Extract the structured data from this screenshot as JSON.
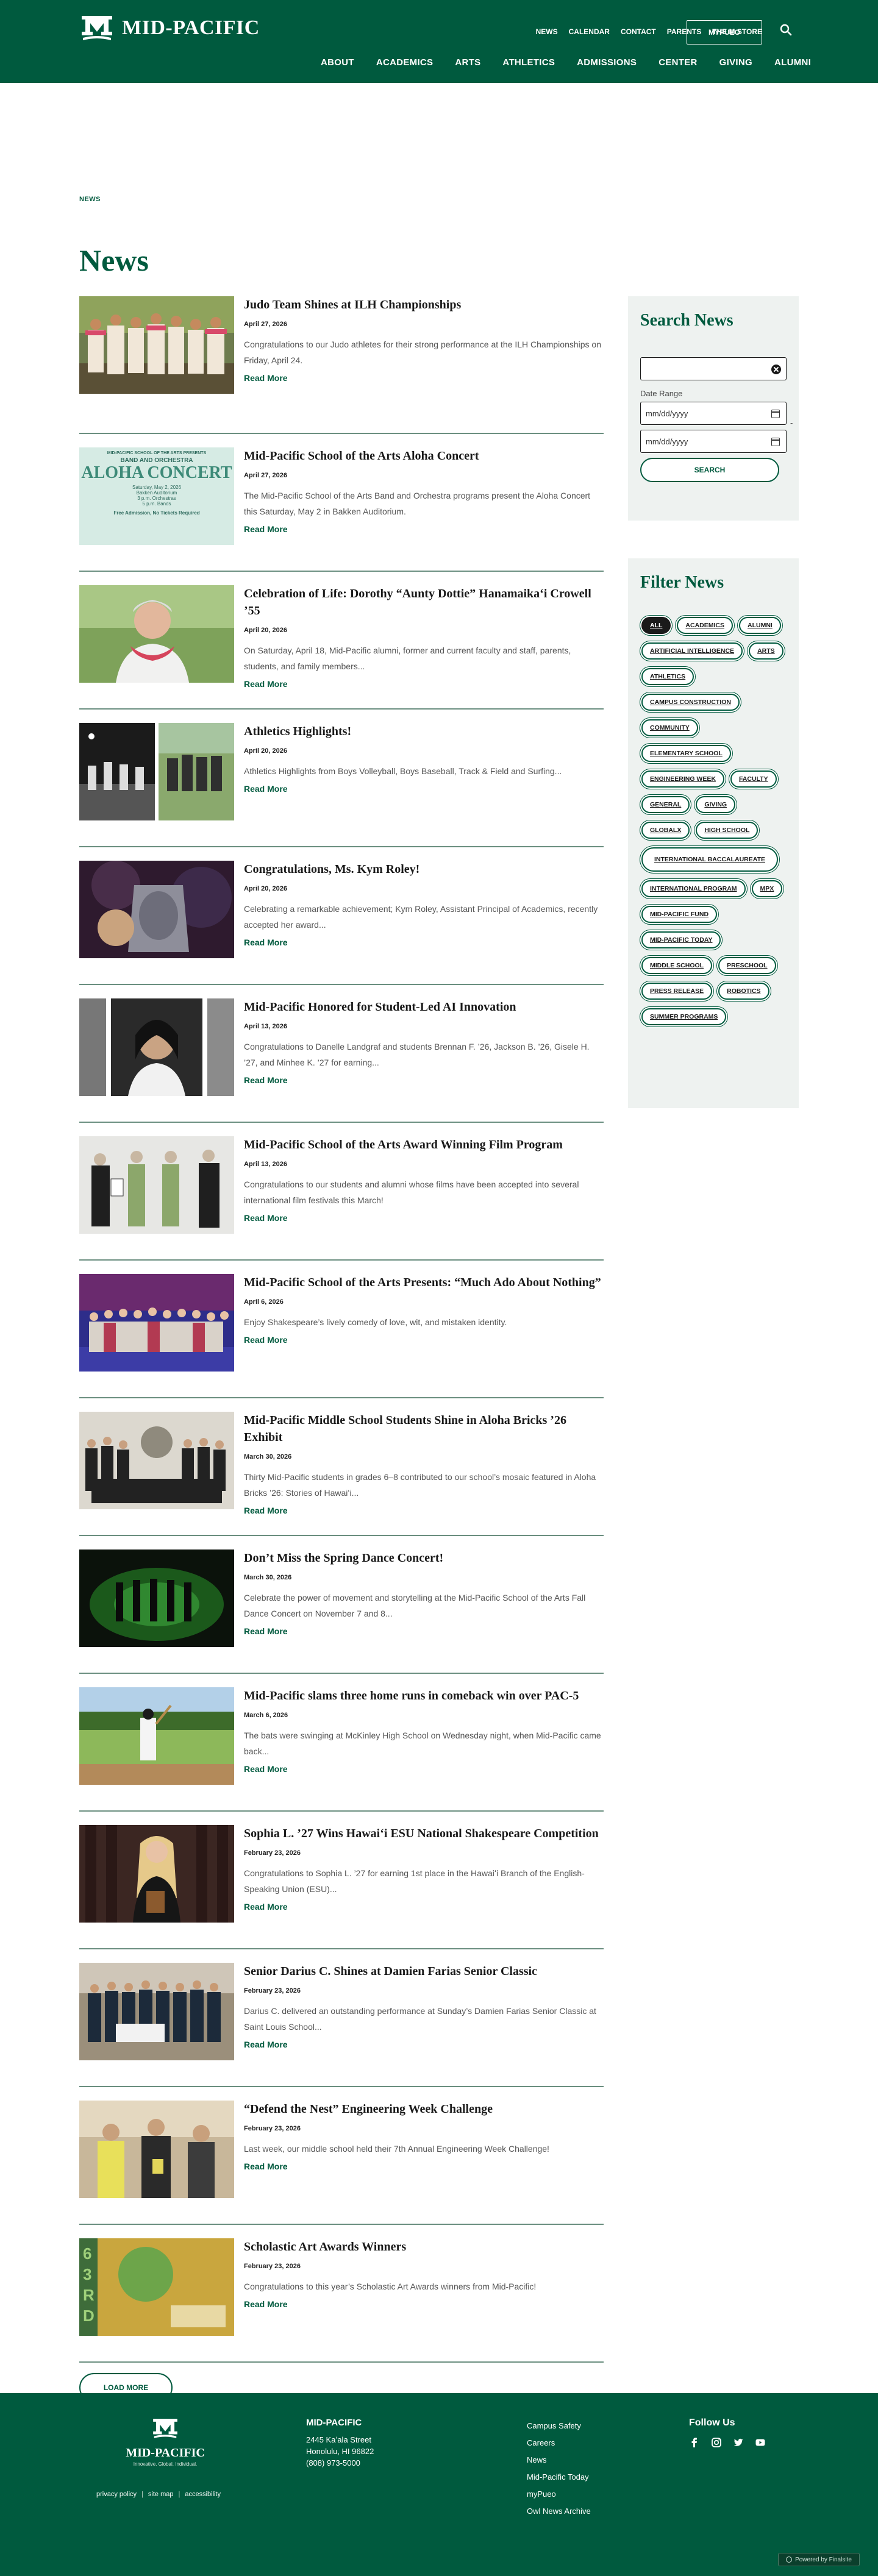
{
  "header": {
    "logo_text": "MID-PACIFIC",
    "util_nav": [
      "NEWS",
      "CALENDAR",
      "CONTACT",
      "PARENTS",
      "THE M STORE"
    ],
    "mypueo_label": "MYPUEO",
    "main_nav": [
      "ABOUT",
      "ACADEMICS",
      "ARTS",
      "ATHLETICS",
      "ADMISSIONS",
      "CENTER",
      "GIVING",
      "ALUMNI"
    ]
  },
  "breadcrumb": "NEWS",
  "page_title": "News",
  "read_more_label": "Read More",
  "news": [
    {
      "title": "Judo Team Shines at ILH Championships",
      "date": "April 27, 2026",
      "excerpt": "Congratulations to our Judo athletes for their strong performance at the ILH Championships on Friday, April 24."
    },
    {
      "title": "Mid-Pacific School of the Arts Aloha Concert",
      "date": "April 27, 2026",
      "excerpt": "The Mid-Pacific School of the Arts Band and Orchestra programs present the Aloha Concert this Saturday, May 2 in Bakken Auditorium."
    },
    {
      "title": "Celebration of Life: Dorothy “Aunty Dottie” Hanamaikaʻi Crowell ’55",
      "date": "April 20, 2026",
      "excerpt": "On Saturday, April 18, Mid-Pacific alumni, former and current faculty and staff, parents, students, and family members..."
    },
    {
      "title": "Athletics Highlights!",
      "date": "April 20, 2026",
      "excerpt": "Athletics Highlights from Boys Volleyball, Boys Baseball, Track & Field and Surfing..."
    },
    {
      "title": "Congratulations, Ms. Kym Roley!",
      "date": "April 20, 2026",
      "excerpt": "Celebrating a remarkable achievement; Kym Roley, Assistant Principal of Academics, recently accepted her award..."
    },
    {
      "title": "Mid-Pacific Honored for Student-Led AI Innovation",
      "date": "April 13, 2026",
      "excerpt": "Congratulations to Danelle Landgraf and students Brennan F. ’26, Jackson B. ’26, Gisele H. ’27, and Minhee K. ’27 for earning..."
    },
    {
      "title": "Mid-Pacific School of the Arts Award Winning Film Program",
      "date": "April 13, 2026",
      "excerpt": "Congratulations to our students and alumni whose films have been accepted into several international film festivals this March!"
    },
    {
      "title": "Mid-Pacific School of the Arts Presents: “Much Ado About Nothing”",
      "date": "April 6, 2026",
      "excerpt": "Enjoy Shakespeare’s lively comedy of love, wit, and mistaken identity."
    },
    {
      "title": "Mid-Pacific Middle School Students Shine in Aloha Bricks ’26 Exhibit",
      "date": "March 30, 2026",
      "excerpt": "Thirty Mid-Pacific students in grades 6–8 contributed to our school’s mosaic featured in Aloha Bricks ’26: Stories of Hawaiʻi..."
    },
    {
      "title": "Don’t Miss the Spring Dance Concert!",
      "date": "March 30, 2026",
      "excerpt": "Celebrate the power of movement and storytelling at the Mid-Pacific School of the Arts Fall Dance Concert on November 7 and 8..."
    },
    {
      "title": "Mid-Pacific slams three home runs in comeback win over PAC-5",
      "date": "March 6, 2026",
      "excerpt": "The bats were swinging at McKinley High School on Wednesday night, when Mid-Pacific came back..."
    },
    {
      "title": "Sophia L. ’27 Wins Hawaiʻi ESU National Shakespeare Competition",
      "date": "February 23, 2026",
      "excerpt": "Congratulations to Sophia L. ’27 for earning 1st place in the Hawaiʻi Branch of the English-Speaking Union (ESU)..."
    },
    {
      "title": "Senior Darius C. Shines at Damien Farias Senior Classic",
      "date": "February 23, 2026",
      "excerpt": "Darius C. delivered an outstanding performance at Sunday’s Damien Farias Senior Classic at Saint Louis School..."
    },
    {
      "title": "“Defend the Nest” Engineering Week Challenge",
      "date": "February 23, 2026",
      "excerpt": "Last week, our middle school held their 7th Annual Engineering Week Challenge!"
    },
    {
      "title": "Scholastic Art Awards Winners",
      "date": "February 23, 2026",
      "excerpt": "Congratulations to this year’s Scholastic Art Awards winners from Mid-Pacific!"
    }
  ],
  "load_more_label": "LOAD MORE",
  "search_panel": {
    "heading": "Search News",
    "date_range_label": "Date Range",
    "date_placeholder": "mm/dd/yyyy",
    "dash": "-",
    "search_button": "SEARCH"
  },
  "filter_panel": {
    "heading": "Filter News",
    "tags": [
      "ALL",
      "ACADEMICS",
      "ALUMNI",
      "ARTIFICIAL INTELLIGENCE",
      "ARTS",
      "ATHLETICS",
      "CAMPUS CONSTRUCTION",
      "COMMUNITY",
      "ELEMENTARY SCHOOL",
      "ENGINEERING WEEK",
      "FACULTY",
      "GENERAL",
      "GIVING",
      "GLOBALX",
      "HIGH SCHOOL",
      "INTERNATIONAL BACCALAUREATE",
      "INTERNATIONAL PROGRAM",
      "MPX",
      "MID-PACIFIC FUND",
      "MID-PACIFIC TODAY",
      "MIDDLE SCHOOL",
      "PRESCHOOL",
      "PRESS RELEASE",
      "ROBOTICS",
      "SUMMER PROGRAMS"
    ]
  },
  "aloha_concert": {
    "school": "MID-PACIFIC SCHOOL OF THE ARTS PRESENTS",
    "program": "BAND AND ORCHESTRA",
    "title": "ALOHA CONCERT",
    "details": [
      "Saturday, May 2, 2026",
      "Bakken Auditorium",
      "3 p.m. Orchestras",
      "5 p.m. Bands"
    ],
    "footer": "Free Admission, No Tickets Required"
  },
  "scholastic_thumb": {
    "big": "63RD"
  },
  "footer": {
    "logo_text": "MID-PACIFIC",
    "tagline": "Innovative. Global. Individual.",
    "legal": [
      "privacy policy",
      "site map",
      "accessibility"
    ],
    "address": {
      "name": "MID-PACIFIC",
      "lines": [
        "2445 Kaʻala Street",
        "Honolulu, HI 96822",
        "(808) 973-5000"
      ]
    },
    "links": [
      "Campus Safety",
      "Careers",
      "News",
      "Mid-Pacific Today",
      "myPueo",
      "Owl News Archive"
    ],
    "follow_heading": "Follow Us",
    "powered_by": "Powered by Finalsite"
  },
  "colors": {
    "brand": "#005a3e",
    "panel": "#eef2f0"
  }
}
